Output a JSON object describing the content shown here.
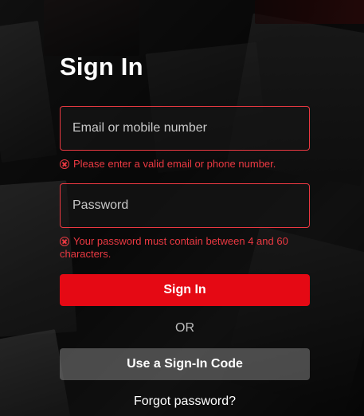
{
  "signin": {
    "title": "Sign In",
    "email_placeholder": "Email or mobile number",
    "email_error": "Please enter a valid email or phone number.",
    "password_placeholder": "Password",
    "password_error": "Your password must contain between 4 and 60 characters.",
    "signin_button": "Sign In",
    "or_text": "OR",
    "code_button": "Use a Sign-In Code",
    "forgot_link": "Forgot password?"
  },
  "colors": {
    "accent": "#e50914",
    "error": "#eb3942"
  }
}
